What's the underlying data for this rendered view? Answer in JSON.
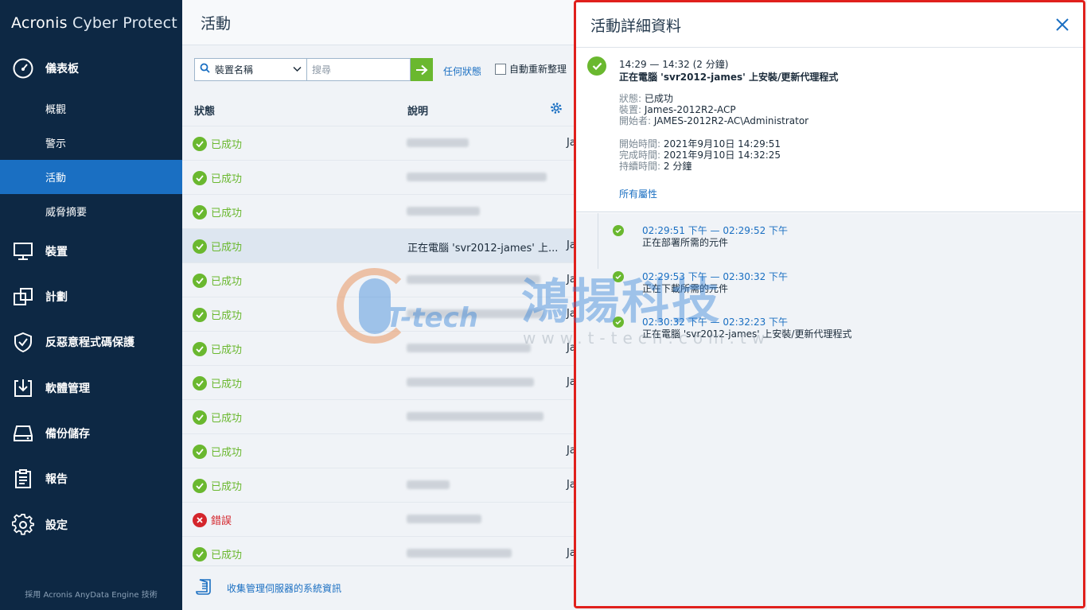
{
  "sidebar": {
    "logo_brand": "Acronis",
    "logo_product": "Cyber Protect",
    "dashboard": "儀表板",
    "overview": "概觀",
    "alerts": "警示",
    "activities": "活動",
    "threat_feed": "威脅摘要",
    "devices": "裝置",
    "plans": "計劃",
    "antimalware": "反惡意程式碼保護",
    "software": "軟體管理",
    "backup_storage": "備份儲存",
    "reports": "報告",
    "settings": "設定",
    "footer": "採用 Acronis AnyData Engine 技術"
  },
  "main": {
    "title": "活動",
    "filter_dropdown": "裝置名稱",
    "search_placeholder": "搜尋",
    "status_filter": "任何狀態",
    "auto_refresh": "自動重新整理",
    "col_status": "狀態",
    "col_description": "說明",
    "footer_link": "收集管理伺服器的系統資訊",
    "rows": [
      {
        "status": "已成功",
        "desc": "",
        "col3": "Ja"
      },
      {
        "status": "已成功",
        "desc": "",
        "col3": ""
      },
      {
        "status": "已成功",
        "desc": "",
        "col3": ""
      },
      {
        "status": "已成功",
        "desc": "正在電腦 'svr2012-james' 上...",
        "col3": "Ja"
      },
      {
        "status": "已成功",
        "desc": "",
        "col3": "Ja"
      },
      {
        "status": "已成功",
        "desc": "",
        "col3": "Ja"
      },
      {
        "status": "已成功",
        "desc": "",
        "col3": "Ja"
      },
      {
        "status": "已成功",
        "desc": "",
        "col3": "Ja"
      },
      {
        "status": "已成功",
        "desc": "",
        "col3": ""
      },
      {
        "status": "已成功",
        "desc": "",
        "col3": "Ja"
      },
      {
        "status": "已成功",
        "desc": "",
        "col3": "Ja"
      },
      {
        "status": "錯誤",
        "desc": "",
        "col3": ""
      },
      {
        "status": "已成功",
        "desc": "",
        "col3": "Ja"
      }
    ]
  },
  "details": {
    "title": "活動詳細資料",
    "time_range": "14:29 — 14:32 (2 分鐘)",
    "activity": "正在電腦 'svr2012-james' 上安裝/更新代理程式",
    "status_label": "狀態:",
    "status_value": "已成功",
    "device_label": "裝置:",
    "device_value": "James-2012R2-ACP",
    "started_by_label": "開始者:",
    "started_by_value": "JAMES-2012R2-AC\\Administrator",
    "start_label": "開始時間:",
    "start_value": "2021年9月10日 14:29:51",
    "finish_label": "完成時間:",
    "finish_value": "2021年9月10日 14:32:25",
    "duration_label": "持續時間:",
    "duration_value": "2 分鐘",
    "all_properties": "所有屬性",
    "steps": [
      {
        "time": "02:29:51 下午 — 02:29:52 下午",
        "desc": "正在部署所需的元件"
      },
      {
        "time": "02:29:53 下午 — 02:30:32 下午",
        "desc": "正在下載所需的元件"
      },
      {
        "time": "02:30:32 下午 — 02:32:23 下午",
        "desc": "正在電腦 'svr2012-james' 上安裝/更新代理程式"
      }
    ]
  },
  "watermark": {
    "chinese": "鴻揚科技",
    "english": "T-tech",
    "url": "www.t-tech.com.tw"
  },
  "colors": {
    "sidebar_bg": "#0d2844",
    "active_nav": "#1a6fc2",
    "success": "#6ab82f",
    "error": "#d4262c",
    "highlight_border": "#e0201c"
  }
}
